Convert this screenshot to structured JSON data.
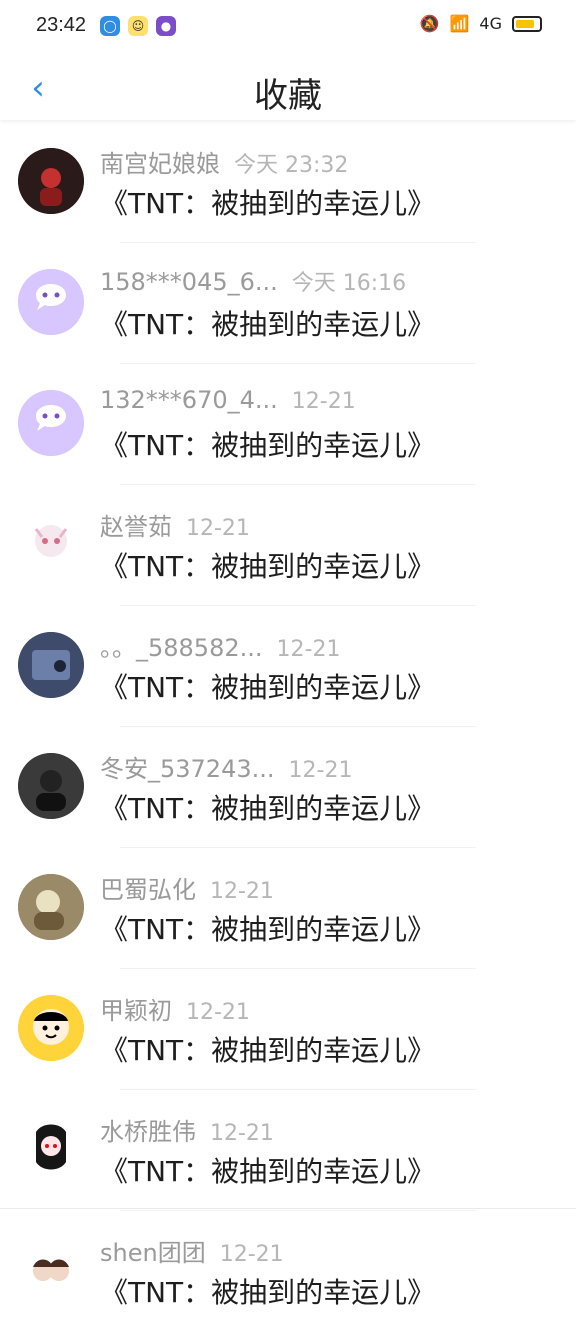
{
  "statusbar": {
    "time": "23:42",
    "icons": [
      "circle-q-icon",
      "emoji-icon",
      "purple-dot-icon"
    ],
    "signal": "4G",
    "battery_color": "#f5c400"
  },
  "navbar": {
    "title": "收藏",
    "back_icon": "chevron-left-icon",
    "accent": "#2f8de4"
  },
  "items": [
    {
      "user": "南宫妃娘娘",
      "time": "今天 23:32",
      "title": "《TNT：被抽到的幸运儿》"
    },
    {
      "user": "158***045_6...",
      "time": "今天 16:16",
      "title": "《TNT：被抽到的幸运儿》"
    },
    {
      "user": "132***670_4...",
      "time": "12-21",
      "title": "《TNT：被抽到的幸运儿》"
    },
    {
      "user": "赵誉茹",
      "time": "12-21",
      "title": "《TNT：被抽到的幸运儿》"
    },
    {
      "user": "。。_588582...",
      "time": "12-21",
      "title": "《TNT：被抽到的幸运儿》"
    },
    {
      "user": "冬安_537243...",
      "time": "12-21",
      "title": "《TNT：被抽到的幸运儿》"
    },
    {
      "user": "巴蜀弘化",
      "time": "12-21",
      "title": "《TNT：被抽到的幸运儿》"
    },
    {
      "user": "甲颖初",
      "time": "12-21",
      "title": "《TNT：被抽到的幸运儿》"
    },
    {
      "user": "水桥胜伟",
      "time": "12-21",
      "title": "《TNT：被抽到的幸运儿》"
    },
    {
      "user": "shen团团",
      "time": "12-21",
      "title": "《TNT：被抽到的幸运儿》"
    }
  ]
}
